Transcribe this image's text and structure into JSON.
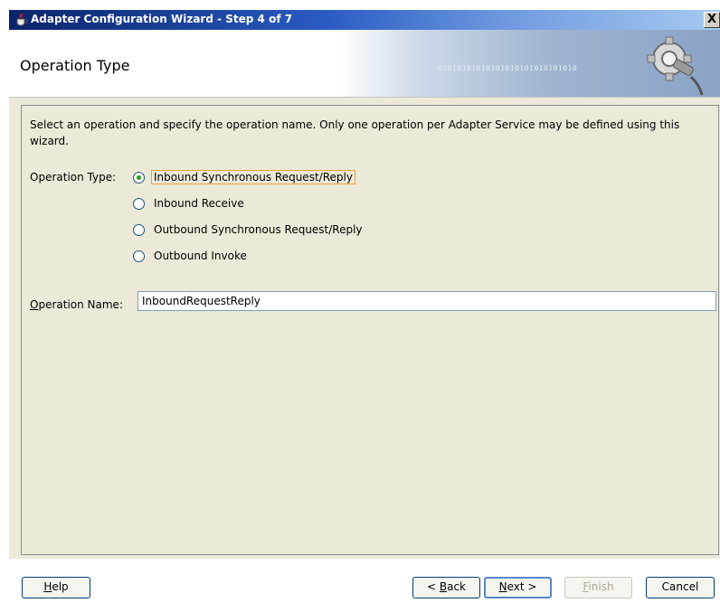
{
  "window": {
    "title": "Adapter Configuration Wizard - Step 4 of 7",
    "close_glyph": "X"
  },
  "header": {
    "heading": "Operation Type",
    "banner_bits": "01010101010101010101010101010"
  },
  "content": {
    "description": "Select an operation and specify the operation name. Only one operation per Adapter Service may be defined using this wizard.",
    "operation_type_label": "Operation Type:",
    "options": [
      {
        "label": "Inbound Synchronous Request/Reply",
        "selected": true
      },
      {
        "label": "Inbound Receive",
        "selected": false
      },
      {
        "label": "Outbound Synchronous Request/Reply",
        "selected": false
      },
      {
        "label": "Outbound Invoke",
        "selected": false
      }
    ],
    "operation_name_label_mnemonic": "O",
    "operation_name_label_rest": "peration Name:",
    "operation_name_value": "InboundRequestReply"
  },
  "buttons": {
    "help": {
      "mnemonic": "H",
      "rest": "elp"
    },
    "back": {
      "prefix": "< ",
      "mnemonic": "B",
      "rest": "ack"
    },
    "next": {
      "mnemonic": "N",
      "rest": "ext >"
    },
    "finish": {
      "mnemonic": "F",
      "rest": "inish"
    },
    "cancel": {
      "label": "Cancel"
    }
  },
  "colors": {
    "titlebar_start": "#0a246a",
    "titlebar_end": "#a6caf0",
    "dialog_bg": "#ece9d8",
    "focus_outline": "#e8a33d",
    "radio_dot": "#21a121"
  }
}
